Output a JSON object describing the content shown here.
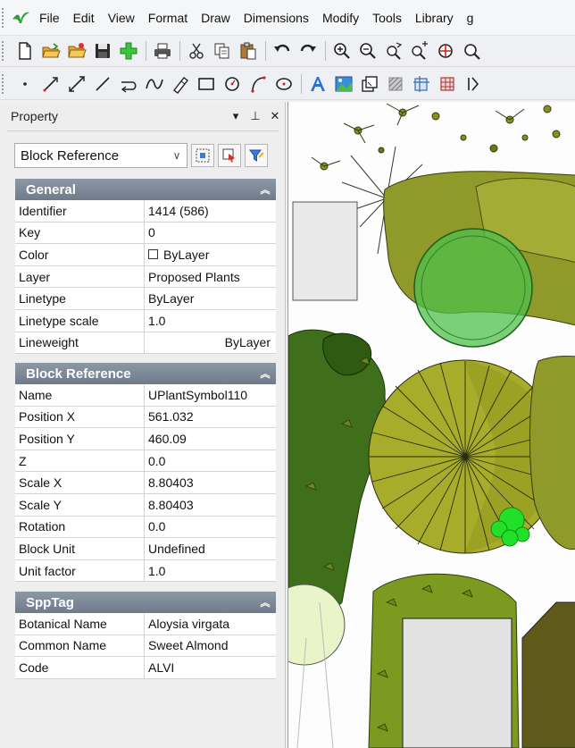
{
  "menubar": {
    "items": [
      "File",
      "Edit",
      "View",
      "Format",
      "Draw",
      "Dimensions",
      "Modify",
      "Tools",
      "Library",
      "g"
    ]
  },
  "toolbar1": {
    "buttons": [
      "new-icon",
      "open-icon",
      "open-folder-icon",
      "save-icon",
      "add-icon",
      "print-icon",
      "cut-icon",
      "copy-icon",
      "paste-icon",
      "undo-icon",
      "redo-icon",
      "zoom-in-icon",
      "zoom-out-icon",
      "zoom-realtime-icon",
      "zoom-window-icon",
      "zoom-extents-icon",
      "zoom-previous-icon"
    ]
  },
  "toolbar2": {
    "buttons": [
      "point-icon",
      "ray-icon",
      "construction-line-icon",
      "line-icon",
      "polyline-icon",
      "spline-icon",
      "ellipse-icon",
      "rectangle-icon",
      "circle-icon",
      "arc-icon",
      "ellipse-center-icon",
      "text-icon",
      "image-icon",
      "block-icon",
      "hatch-icon",
      "trim-icon",
      "array-icon",
      "more-icon"
    ]
  },
  "panel": {
    "title": "Property",
    "pin_glyph": "⊥",
    "close_glyph": "✕",
    "dropdown_glyph": "▾"
  },
  "selector": {
    "value": "Block Reference"
  },
  "sections": {
    "general": {
      "title": "General",
      "rows": [
        {
          "name": "Identifier",
          "value": "1414 (586)"
        },
        {
          "name": "Key",
          "value": "0"
        },
        {
          "name": "Color",
          "value": "ByLayer"
        },
        {
          "name": "Layer",
          "value": "Proposed Plants"
        },
        {
          "name": "Linetype",
          "value": "ByLayer"
        },
        {
          "name": "Linetype scale",
          "value": "1.0"
        },
        {
          "name": "Lineweight",
          "value": "ByLayer"
        }
      ]
    },
    "block_reference": {
      "title": "Block Reference",
      "rows": [
        {
          "name": "Name",
          "value": "UPlantSymbol110"
        },
        {
          "name": "Position X",
          "value": "561.032"
        },
        {
          "name": "Position Y",
          "value": "460.09"
        },
        {
          "name": "Z",
          "value": "0.0"
        },
        {
          "name": "Scale X",
          "value": "8.80403"
        },
        {
          "name": "Scale Y",
          "value": "8.80403"
        },
        {
          "name": "Rotation",
          "value": "0.0"
        },
        {
          "name": "Block Unit",
          "value": "Undefined"
        },
        {
          "name": "Unit factor",
          "value": "1.0"
        }
      ]
    },
    "spp_tag": {
      "title": "SppTag",
      "rows": [
        {
          "name": "Botanical Name",
          "value": "Aloysia virgata"
        },
        {
          "name": "Common Name",
          "value": "Sweet Almond"
        },
        {
          "name": "Code",
          "value": "ALVI"
        }
      ]
    }
  },
  "colors": {
    "section_header": "#7b8695",
    "canvas_bg": "#fdfdfd",
    "plant_olive": "#8f9a2a",
    "plant_green": "#3f7a1a",
    "plant_light": "#a8c850",
    "bright_green": "#22e02a"
  }
}
